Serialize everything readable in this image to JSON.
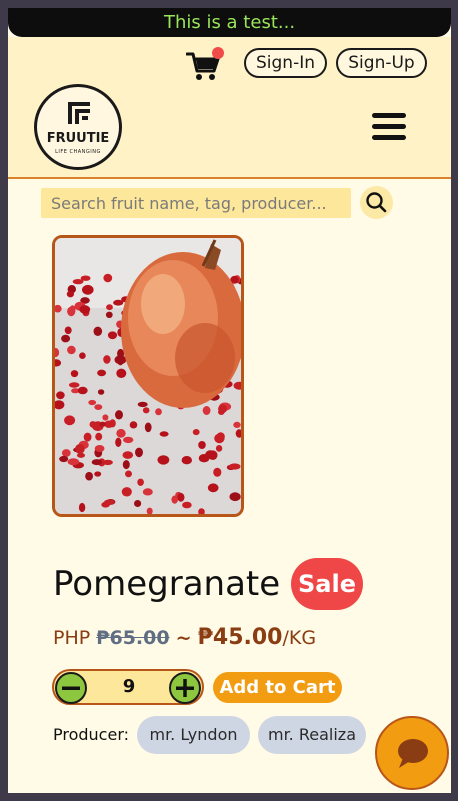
{
  "banner": {
    "text": "This is a test..."
  },
  "header": {
    "sign_in_label": "Sign-In",
    "sign_up_label": "Sign-Up",
    "logo": {
      "name": "FRUUTIE",
      "tagline": "LIFE CHANGING"
    }
  },
  "search": {
    "placeholder": "Search fruit name, tag, producer..."
  },
  "product": {
    "name": "Pomegranate",
    "badge": "Sale",
    "currency": "PHP",
    "old_price": "₱65.00",
    "separator": "~",
    "price": "₱45.00",
    "unit": "/KG",
    "quantity": "9",
    "add_to_cart_label": "Add to Cart",
    "producer_label": "Producer:",
    "producers": [
      "mr. Lyndon",
      "mr. Realiza"
    ]
  },
  "icons": {
    "cart": "cart-icon",
    "menu": "hamburger-menu-icon",
    "search": "search-icon",
    "minus": "minus-icon",
    "plus": "plus-icon",
    "chat": "chat-bubble-icon"
  },
  "colors": {
    "accent_orange": "#f29c12",
    "sale_red": "#ef4747",
    "header_bg": "#fff2c6",
    "banner_text": "#9ae65a",
    "price_brown": "#8a3c12"
  }
}
